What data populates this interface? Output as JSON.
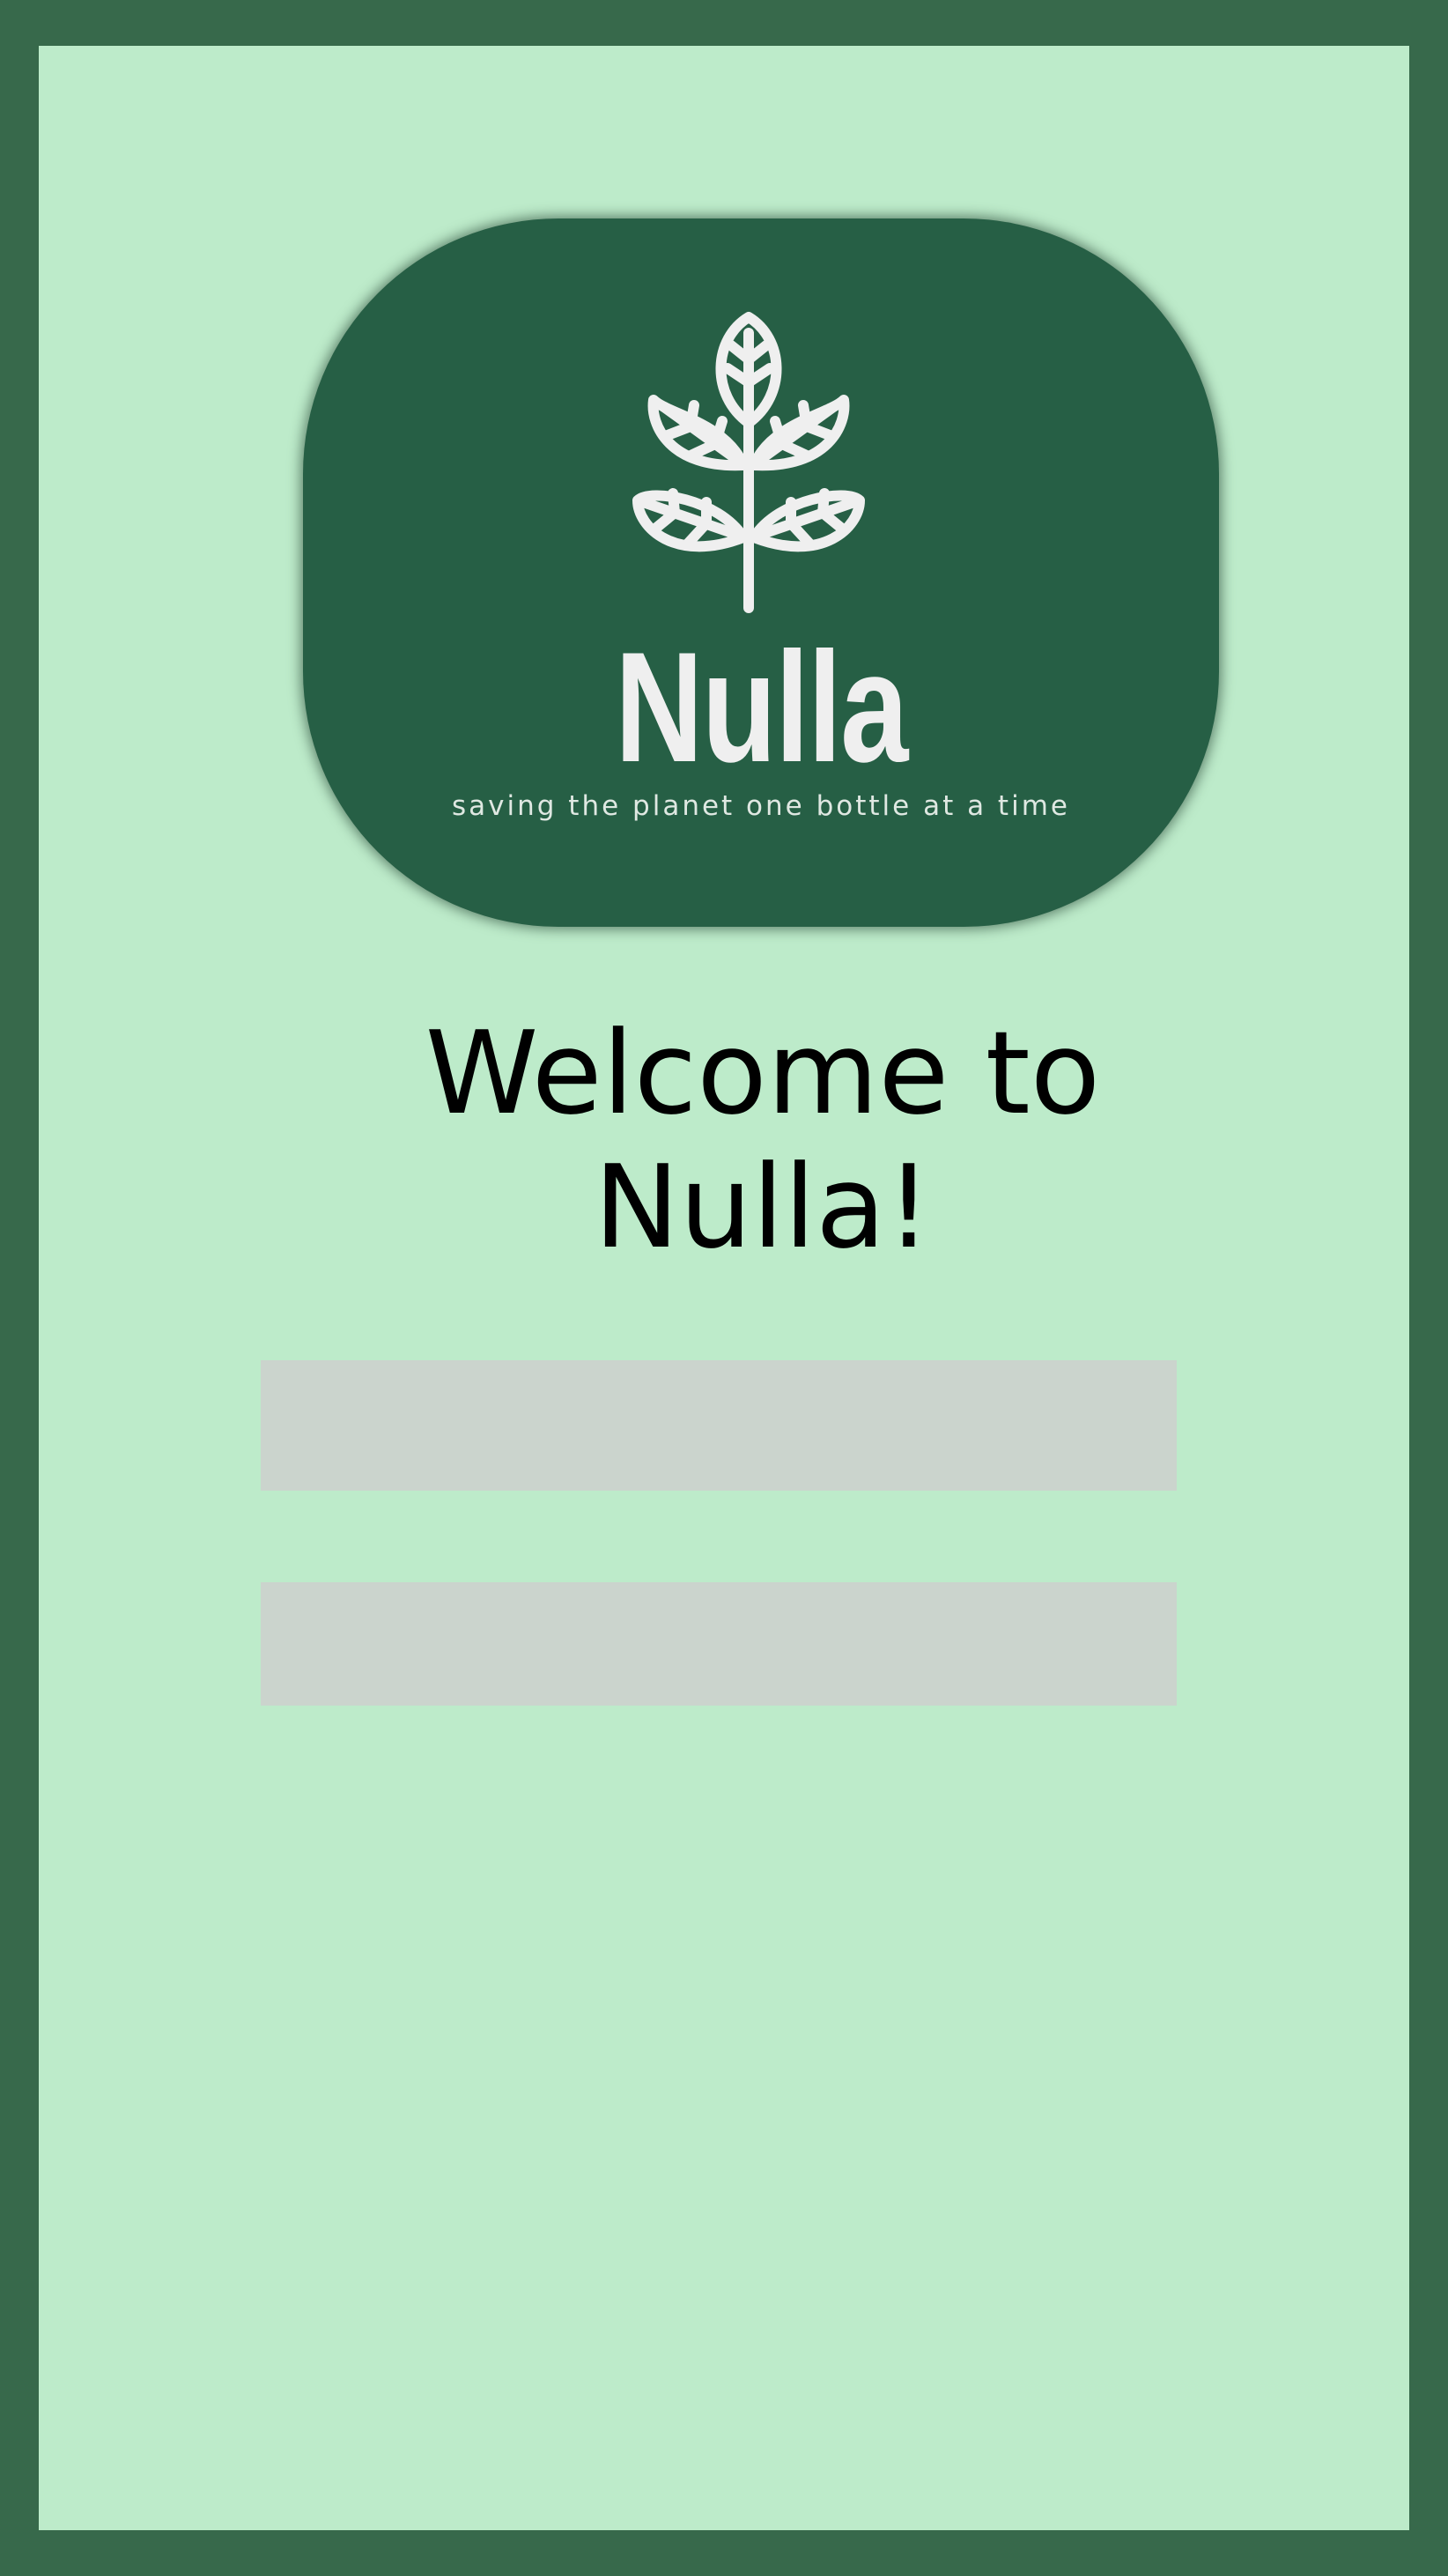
{
  "brand": {
    "name": "Nulla",
    "tagline": "saving the planet one bottle at a time",
    "logo_icon": "leaf-branch-icon"
  },
  "welcome": {
    "line1": "Welcome to",
    "line2": "Nulla!"
  },
  "form": {
    "field1": {
      "value": "",
      "placeholder": ""
    },
    "field2": {
      "value": "",
      "placeholder": ""
    }
  },
  "colors": {
    "outer_frame": "#37694b",
    "background": "#bdebca",
    "logo_card": "#265f45",
    "logo_foreground": "#efefef",
    "field_background": "#cbd4cd",
    "text": "#000000"
  }
}
